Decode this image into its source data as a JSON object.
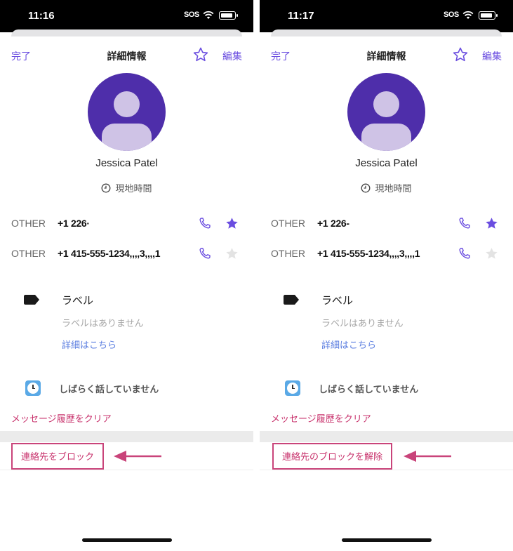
{
  "screens": [
    {
      "status_time": "11:16",
      "status_sos": "SOS",
      "nav": {
        "done": "完了",
        "title": "詳細情報",
        "edit": "編集"
      },
      "contact_name": "Jessica Patel",
      "local_time": "現地時間",
      "phones": [
        {
          "type": "OTHER",
          "number": "+1 226·",
          "favorite": true
        },
        {
          "type": "OTHER",
          "number": "+1 415-555-1234,,,,3,,,,1",
          "favorite": false
        }
      ],
      "label_title": "ラベル",
      "label_empty": "ラベルはありません",
      "label_link": "詳細はこちら",
      "recent": "しばらく話していません",
      "clear_history": "メッセージ履歴をクリア",
      "block_action": "連絡先をブロック"
    },
    {
      "status_time": "11:17",
      "status_sos": "SOS",
      "nav": {
        "done": "完了",
        "title": "詳細情報",
        "edit": "編集"
      },
      "contact_name": "Jessica Patel",
      "local_time": "現地時間",
      "phones": [
        {
          "type": "OTHER",
          "number": "+1 226-",
          "favorite": true
        },
        {
          "type": "OTHER",
          "number": "+1 415-555-1234,,,,3,,,,1",
          "favorite": false
        }
      ],
      "label_title": "ラベル",
      "label_empty": "ラベルはありません",
      "label_link": "詳細はこちら",
      "recent": "しばらく話していません",
      "clear_history": "メッセージ履歴をクリア",
      "block_action": "連絡先のブロックを解除"
    }
  ],
  "colors": {
    "accent": "#6a4de0",
    "avatar_bg": "#4e2eaa",
    "danger": "#c8326c",
    "annotation": "#c9447a",
    "link": "#5b7ee0"
  },
  "icons": [
    "star-outline-icon",
    "phone-icon",
    "star-filled-icon",
    "label-tag-icon",
    "clock-icon",
    "wifi-icon",
    "battery-icon",
    "arrow-left-icon"
  ]
}
